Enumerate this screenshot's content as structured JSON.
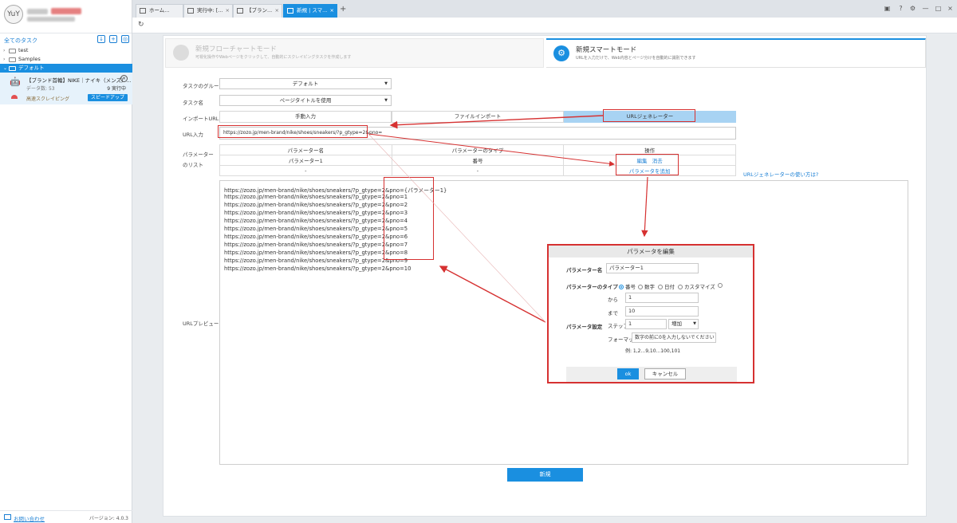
{
  "sidebar": {
    "avatar_text": "YuY",
    "all_tasks_label": "全てのタスク",
    "tree": [
      {
        "label": "test"
      },
      {
        "label": "Samples"
      },
      {
        "label": "デフォルト"
      }
    ],
    "task": {
      "title": "【ブランド首輪】NIKE｜ナイキ（メンズ）...",
      "data_count_label": "データ数:",
      "data_count_value": "53",
      "count_status": "9 実行中",
      "mode_label": "高速スクレイピング",
      "speedup_label": "スピードアップ"
    },
    "contact_label": "お問い合わせ",
    "version": "バージョン: 4.0.3"
  },
  "tabs": [
    {
      "label": "ホーム..."
    },
    {
      "label": "実行中: [..."
    },
    {
      "label": "【ブラン..."
    },
    {
      "label": "新規 | スマ..."
    }
  ],
  "modes": {
    "flow": {
      "title": "新規フローチャートモード",
      "desc": "可視化操作やWebページをクリックして、自動的にスクレイピングタスクを作成します"
    },
    "smart": {
      "title": "新規スマートモード",
      "desc": "URLを入力だけで、Web内容とページ分けを自動的に識別できます"
    }
  },
  "form": {
    "group_label": "タスクのグループ",
    "group_value": "デフォルト",
    "name_label": "タスク名",
    "name_value": "ページタイトルを使用",
    "import_label": "インポートURL",
    "import_tabs": [
      "手動入力",
      "ファイルインポート",
      "URLジェネレーター"
    ],
    "url_label": "URL入力",
    "url_value": "https://zozo.jp/men-brand/nike/shoes/sneakers/?p_gtype=2&pno=",
    "param_list_label": "パラメーターのリスト",
    "param_headers": [
      "パラメーター名",
      "パラメーターのタイプ",
      "操作"
    ],
    "param_row": {
      "name": "パラメーター1",
      "type": "番号",
      "edit": "編集",
      "delete": "消去"
    },
    "empty_row": [
      "-",
      "-"
    ],
    "add_param": "パラメータを追加",
    "help_link": "URLジェネレーターの使い方は?",
    "preview_label": "URLプレビュー",
    "preview_lines": [
      "https://zozo.jp/men-brand/nike/shoes/sneakers/?p_gtype=2&pno={パラメーター1}",
      "https://zozo.jp/men-brand/nike/shoes/sneakers/?p_gtype=2&pno=1",
      "https://zozo.jp/men-brand/nike/shoes/sneakers/?p_gtype=2&pno=2",
      "https://zozo.jp/men-brand/nike/shoes/sneakers/?p_gtype=2&pno=3",
      "https://zozo.jp/men-brand/nike/shoes/sneakers/?p_gtype=2&pno=4",
      "https://zozo.jp/men-brand/nike/shoes/sneakers/?p_gtype=2&pno=5",
      "https://zozo.jp/men-brand/nike/shoes/sneakers/?p_gtype=2&pno=6",
      "https://zozo.jp/men-brand/nike/shoes/sneakers/?p_gtype=2&pno=7",
      "https://zozo.jp/men-brand/nike/shoes/sneakers/?p_gtype=2&pno=8",
      "https://zozo.jp/men-brand/nike/shoes/sneakers/?p_gtype=2&pno=9",
      "https://zozo.jp/men-brand/nike/shoes/sneakers/?p_gtype=2&pno=10"
    ],
    "create_label": "新規"
  },
  "dialog": {
    "title": "パラメータを編集",
    "name_label": "パラメーター名",
    "name_value": "パラメーター1",
    "type_label": "パラメーターのタイプ",
    "types": [
      "番号",
      "数字",
      "日付",
      "カスタマイズ",
      ""
    ],
    "from_label": "から",
    "from_value": "1",
    "to_label": "まで",
    "to_value": "10",
    "settings_label": "パラメータ設定",
    "step_label": "ステップ",
    "step_value": "1",
    "step_mode": "増加",
    "format_label": "フォーマット",
    "format_value": "数字の前に0を入力しないでください",
    "example": "例: 1,2...9,10...100,101",
    "ok_label": "ok",
    "cancel_label": "キャンセル"
  },
  "colors": {
    "accent": "#1a8fe0",
    "annotation": "#d63131"
  }
}
